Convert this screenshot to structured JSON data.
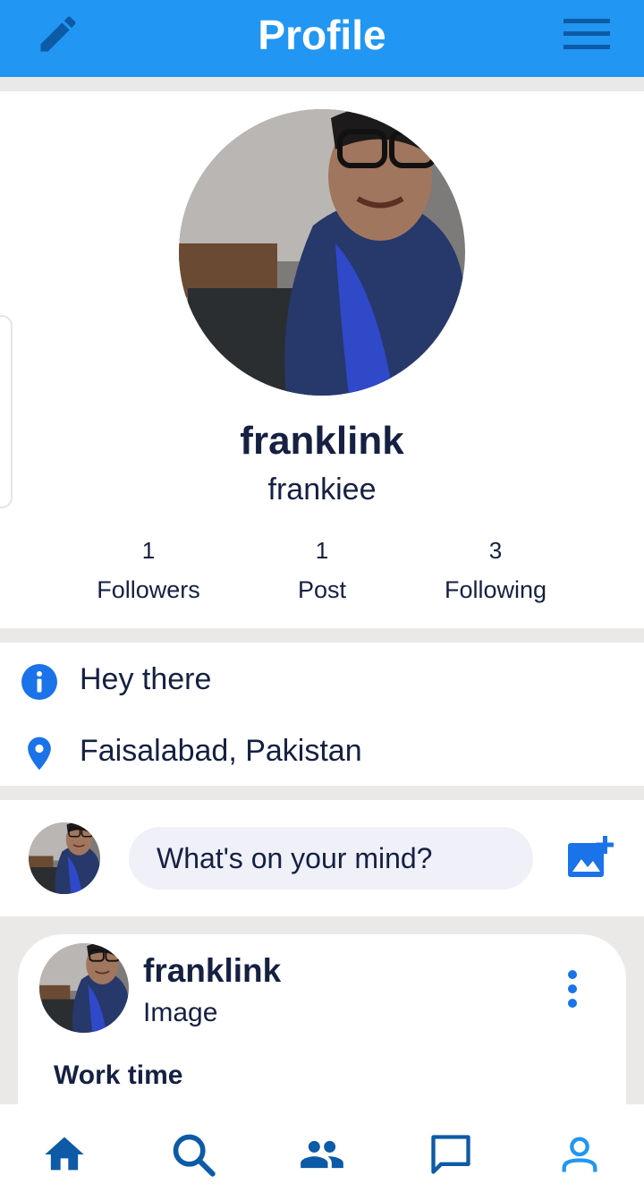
{
  "colors": {
    "primary": "#2196f3",
    "dark_blue": "#0d5aa7",
    "text": "#152042",
    "accent_icon": "#1a73e8"
  },
  "app_bar": {
    "title": "Profile",
    "left_icon": "pencil-edit-icon",
    "right_icon": "hamburger-menu-icon"
  },
  "profile": {
    "display_name": "franklink",
    "username": "frankiee",
    "stats": [
      {
        "value": "1",
        "label": "Followers"
      },
      {
        "value": "1",
        "label": "Post"
      },
      {
        "value": "3",
        "label": "Following"
      }
    ]
  },
  "about": {
    "bio": "Hey there",
    "bio_icon": "info-icon",
    "location": "Faisalabad, Pakistan",
    "location_icon": "location-pin-icon"
  },
  "composer": {
    "placeholder": "What's on your mind?",
    "action_icon": "add-photo-icon"
  },
  "post": {
    "author": "franklink",
    "type": "Image",
    "text": "Work time",
    "menu_icon": "more-vertical-icon"
  },
  "bottom_nav": [
    {
      "icon": "home-icon",
      "active": false
    },
    {
      "icon": "search-icon",
      "active": false
    },
    {
      "icon": "group-icon",
      "active": false
    },
    {
      "icon": "chat-icon",
      "active": false
    },
    {
      "icon": "profile-icon",
      "active": true
    }
  ]
}
